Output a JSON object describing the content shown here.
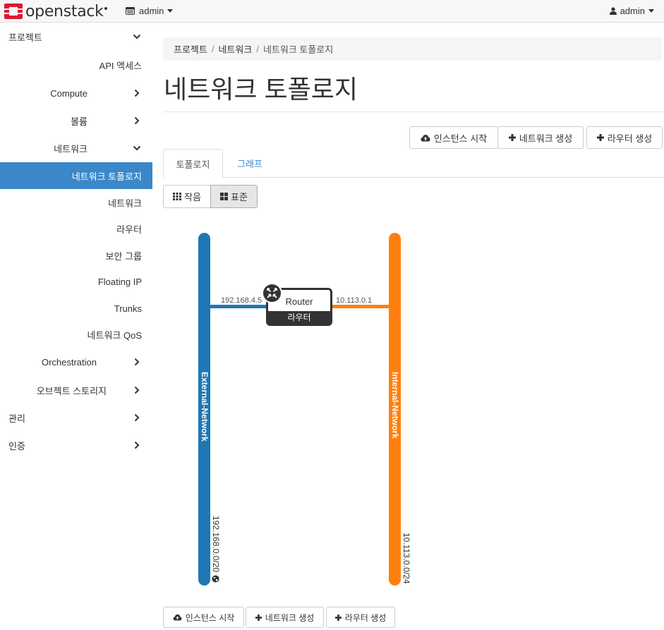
{
  "navbar": {
    "brand": "openstack",
    "project_label": "admin",
    "user_label": "admin"
  },
  "sidebar": {
    "items": [
      {
        "label": "프로젝트",
        "chevron": "down"
      },
      {
        "label": "API 액세스"
      },
      {
        "label": "Compute",
        "chevron": "right"
      },
      {
        "label": "볼륨",
        "chevron": "right"
      },
      {
        "label": "네트워크",
        "chevron": "down"
      },
      {
        "label": "네트워크 토폴로지",
        "active": true
      },
      {
        "label": "네트워크"
      },
      {
        "label": "라우터"
      },
      {
        "label": "보안 그룹"
      },
      {
        "label": "Floating IP"
      },
      {
        "label": "Trunks"
      },
      {
        "label": "네트워크 QoS"
      },
      {
        "label": "Orchestration",
        "chevron": "right"
      },
      {
        "label": "오브젝트 스토리지",
        "chevron": "right"
      },
      {
        "label": "관리",
        "chevron": "right"
      },
      {
        "label": "인증",
        "chevron": "right"
      }
    ]
  },
  "breadcrumb": [
    "프로젝트",
    "네트워크",
    "네트워크 토폴로지"
  ],
  "page_title": "네트워크 토폴로지",
  "actions": {
    "launch_instance": "인스턴스 시작",
    "create_network": "네트워크 생성",
    "create_router": "라우터 생성"
  },
  "tabs": [
    "토폴로지",
    "그래프"
  ],
  "view_toggle": {
    "small": "작음",
    "normal": "표준"
  },
  "topology": {
    "networks": [
      {
        "name": "External-Network",
        "cidr": "192.168.0.0/20",
        "color": "#1f77b4"
      },
      {
        "name": "Internal-Network",
        "cidr": "10.113.0.0/24",
        "color": "#ff7f0e"
      }
    ],
    "router": {
      "name": "Router",
      "type_label": "라우터"
    },
    "ports": [
      {
        "ip": "192.168.4.5"
      },
      {
        "ip": "10.113.0.1"
      }
    ]
  },
  "colors": {
    "accent": "#3a87c9",
    "brand_red": "#da1a32"
  },
  "icons": {
    "upload": "cloud-upload-icon",
    "plus": "plus-icon",
    "small": "th-icon",
    "normal": "th-large-icon",
    "router": "router-arrows-icon",
    "globe": "globe-icon"
  }
}
